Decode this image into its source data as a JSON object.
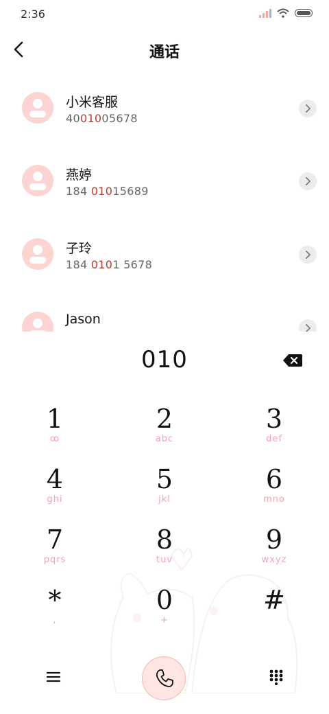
{
  "status_bar": {
    "time": "2:36"
  },
  "header": {
    "title": "通话"
  },
  "contacts": [
    {
      "name": "小米客服",
      "number_pre": "40",
      "number_hl": "010",
      "number_post": "05678"
    },
    {
      "name": "燕婷",
      "number_pre": "184 ",
      "number_hl": "010",
      "number_post": "15689"
    },
    {
      "name": "子玲",
      "number_pre": "184 ",
      "number_hl": "010",
      "number_post": "1 5678"
    },
    {
      "name": "Jason",
      "number_pre": "",
      "number_hl": "",
      "number_post": ""
    }
  ],
  "dialer": {
    "input_value": "010",
    "keys": [
      {
        "digit": "1",
        "letters": "ꝏ"
      },
      {
        "digit": "2",
        "letters": "abc"
      },
      {
        "digit": "3",
        "letters": "def"
      },
      {
        "digit": "4",
        "letters": "ghi"
      },
      {
        "digit": "5",
        "letters": "jkl"
      },
      {
        "digit": "6",
        "letters": "mno"
      },
      {
        "digit": "7",
        "letters": "pqrs"
      },
      {
        "digit": "8",
        "letters": "tuv"
      },
      {
        "digit": "9",
        "letters": "wxyz"
      },
      {
        "digit": "*",
        "letters": ","
      },
      {
        "digit": "0",
        "letters": "+"
      },
      {
        "digit": "#",
        "letters": ""
      }
    ]
  },
  "icons": {
    "back": "chevron-left-icon",
    "detail": "chevron-right-icon",
    "backspace": "backspace-icon",
    "menu": "menu-icon",
    "call": "phone-icon",
    "keypad": "dialpad-icon"
  },
  "colors": {
    "accent_pink": "#fcd4d2",
    "highlight_red": "#c0392b",
    "letters_pink": "#f4a3b0",
    "call_button_bg": "#ffe6e3"
  }
}
